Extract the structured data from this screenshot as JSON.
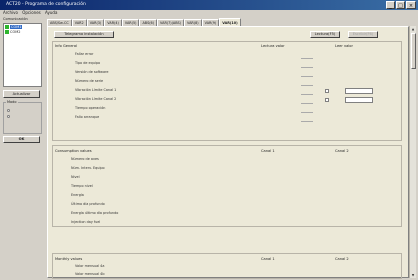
{
  "window": {
    "title": "ACT20 - Programa de configuración"
  },
  "menu": [
    "Archivo",
    "Opciones",
    "Ayuda"
  ],
  "sidebar": {
    "group_label": "Comunicación",
    "tree": [
      {
        "label": "COM1",
        "selected": true
      },
      {
        "label": "COM2",
        "selected": false
      }
    ],
    "actualizar_label": "Actualizar",
    "modo_label": "Modo",
    "radios": [
      "",
      ""
    ],
    "ok_label": "OK"
  },
  "tabs": [
    "ABS/Sw-CC",
    "VAR2",
    "VAR(3)",
    "VAR(4)",
    "VAR(5)",
    "ABS(6)",
    "VAR(7)(ABS)",
    "VAR(8)",
    "VAR(9)",
    "VAR(10)"
  ],
  "toolbar": {
    "telegram_label": "Telegrama instalación",
    "lectura_label": "Lectura(F5)",
    "escribir_label": "Escribir(F6)"
  },
  "info_section": {
    "header": "Info General",
    "col1": "Lectura valor",
    "col2": "Leer valor",
    "rows": [
      "Fallar error",
      "Tipo de equipo",
      "Versión de software",
      "Número de serie",
      "Vibración Límite Canal 1",
      "Vibración Límite Canal 2",
      "Tiempo operación",
      "Fallo arranque"
    ]
  },
  "consumption_section": {
    "header": "Consumption values",
    "col1": "Canal 1",
    "col2": "Canal 2",
    "rows": [
      "Número de aves",
      "Núm. Interv. Equipo",
      "Nivel",
      "Tiempo nivel",
      "Energía",
      "Último día profundo",
      "Energía último día profundo",
      "Injection day fuel"
    ]
  },
  "monthly_section": {
    "header": "Monthly values",
    "col1": "Canal 1",
    "col2": "Canal 2",
    "rows": [
      "Valor mensual 4a",
      "Valor mensual 4b",
      "Valor mensual 4c"
    ]
  }
}
